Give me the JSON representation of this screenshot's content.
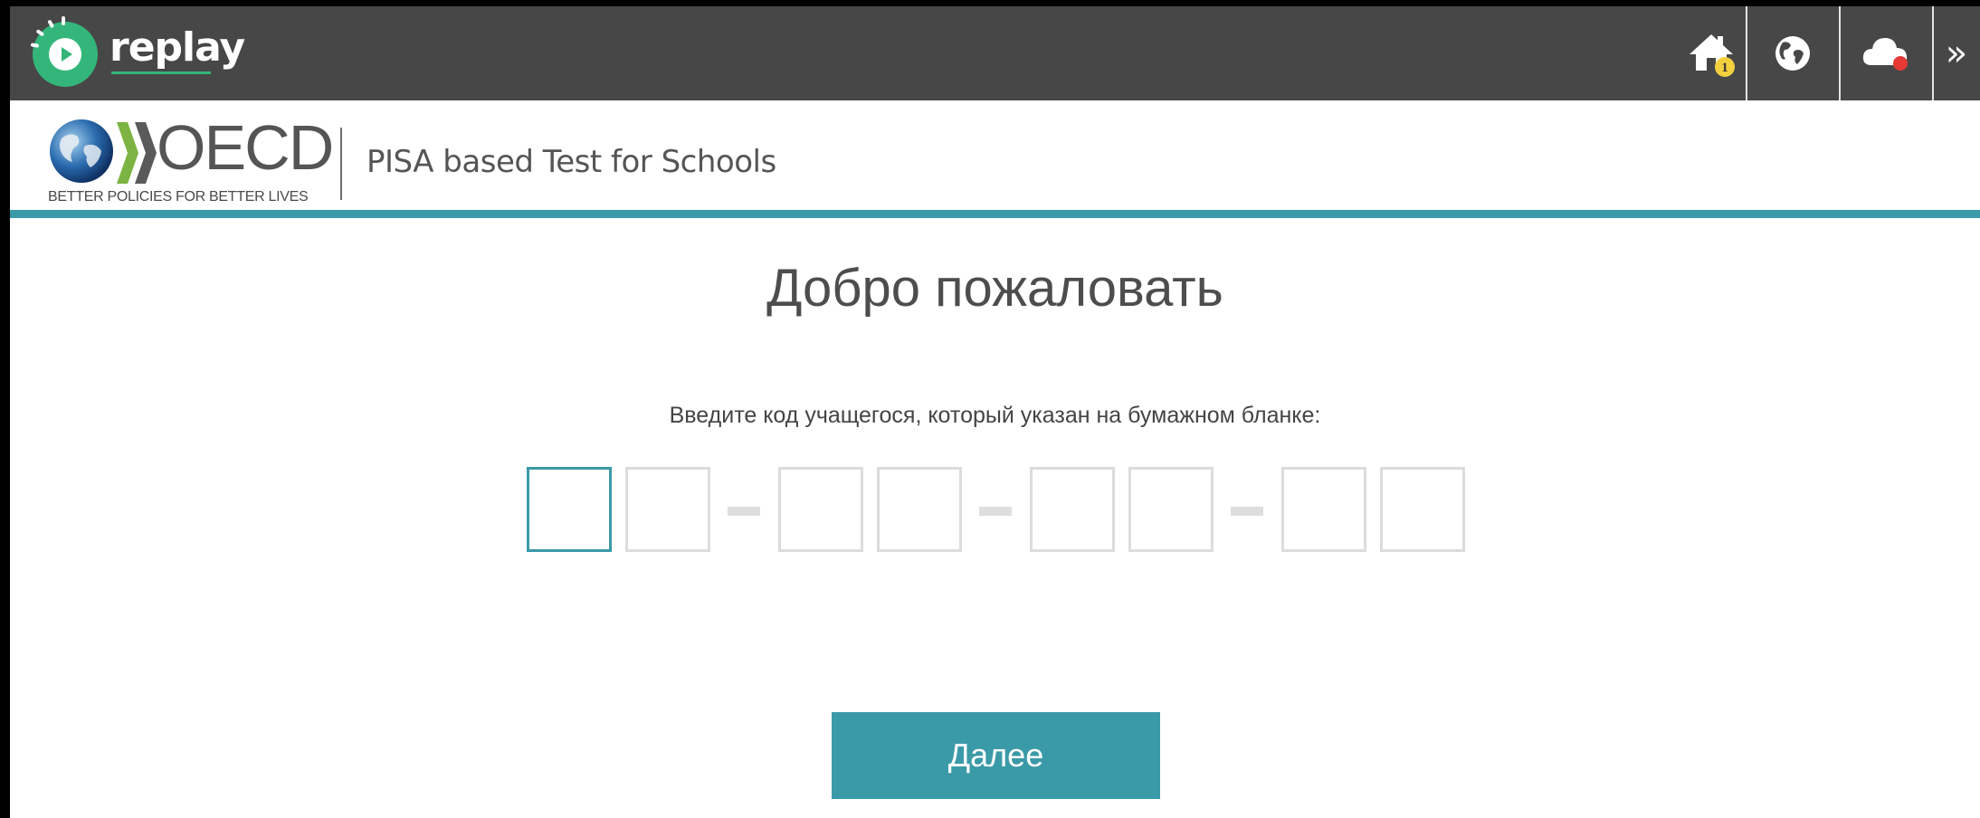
{
  "app": {
    "name": "replay",
    "brand_color": "#34b67a"
  },
  "topbar": {
    "background": "#474747",
    "icons": [
      {
        "name": "home-icon",
        "badge": "1"
      },
      {
        "name": "globe-icon"
      },
      {
        "name": "cloud-icon",
        "status": "red-dot"
      },
      {
        "name": "double-chevron-right-icon",
        "label": "»"
      }
    ]
  },
  "header": {
    "logo_text": "OECD",
    "tagline": "BETTER POLICIES FOR BETTER LIVES",
    "title": "PISA based Test for Schools",
    "accent_color": "#3b9aa8"
  },
  "main": {
    "welcome": "Добро пожаловать",
    "instruction": "Введите код учащегося, который указан на бумажном бланке:",
    "code_values": [
      "",
      "",
      "",
      "",
      "",
      "",
      "",
      ""
    ],
    "separator": "-",
    "next_label": "Далее"
  }
}
